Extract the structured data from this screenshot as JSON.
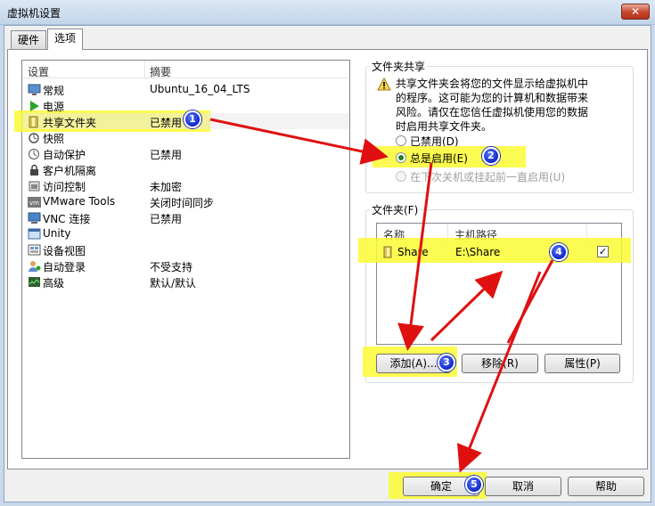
{
  "window": {
    "title": "虚拟机设置",
    "close_label": "✕"
  },
  "tabs": [
    {
      "label": "硬件"
    },
    {
      "label": "选项"
    }
  ],
  "list": {
    "headers": {
      "setting": "设置",
      "summary": "摘要"
    },
    "rows": [
      {
        "name": "常规",
        "summary": "Ubuntu_16_04_LTS",
        "icon": "monitor-icon"
      },
      {
        "name": "电源",
        "summary": "",
        "icon": "play-icon"
      },
      {
        "name": "共享文件夹",
        "summary": "已禁用",
        "icon": "shared-folder-icon"
      },
      {
        "name": "快照",
        "summary": "",
        "icon": "snapshot-icon"
      },
      {
        "name": "自动保护",
        "summary": "已禁用",
        "icon": "autoprotect-icon"
      },
      {
        "name": "客户机隔离",
        "summary": "",
        "icon": "lock-icon"
      },
      {
        "name": "访问控制",
        "summary": "未加密",
        "icon": "access-control-icon"
      },
      {
        "name": "VMware Tools",
        "summary": "关闭时间同步",
        "icon": "vmware-tools-icon"
      },
      {
        "name": "VNC 连接",
        "summary": "已禁用",
        "icon": "vnc-icon"
      },
      {
        "name": "Unity",
        "summary": "",
        "icon": "unity-icon"
      },
      {
        "name": "设备视图",
        "summary": "",
        "icon": "device-view-icon"
      },
      {
        "name": "自动登录",
        "summary": "不受支持",
        "icon": "autologin-icon"
      },
      {
        "name": "高级",
        "summary": "默认/默认",
        "icon": "advanced-icon"
      }
    ]
  },
  "folder_sharing": {
    "group_label": "文件夹共享",
    "warning": "共享文件夹会将您的文件显示给虚拟机中的程序。这可能为您的计算机和数据带来风险。请仅在您信任虚拟机使用您的数据时启用共享文件夹。",
    "warning_lines": [
      "共享文件夹会将您的文件显示给虚拟机中",
      "的程序。这可能为您的计算机和数据带来",
      "风险。请仅在您信任虚拟机使用您的数据",
      "时启用共享文件夹。"
    ],
    "options": [
      {
        "label": "已禁用(D)",
        "selected": false,
        "enabled": true
      },
      {
        "label": "总是启用(E)",
        "selected": true,
        "enabled": true
      },
      {
        "label": "在下次关机或挂起前一直启用(U)",
        "selected": false,
        "enabled": false
      }
    ]
  },
  "folders": {
    "group_label": "文件夹(F)",
    "headers": {
      "name": "名称",
      "host_path": "主机路径"
    },
    "rows": [
      {
        "name": "Share",
        "host_path": "E:\\Share",
        "enabled": true
      }
    ],
    "buttons": {
      "add": "添加(A)...",
      "remove": "移除(R)",
      "properties": "属性(P)"
    }
  },
  "footer": {
    "ok": "确定",
    "cancel": "取消",
    "help": "帮助"
  },
  "annotations": {
    "badges": [
      "1",
      "2",
      "3",
      "4",
      "5"
    ],
    "highlight_color": "#fbfa33",
    "arrow_color": "#e01010",
    "badge_color": "#1026c8"
  }
}
